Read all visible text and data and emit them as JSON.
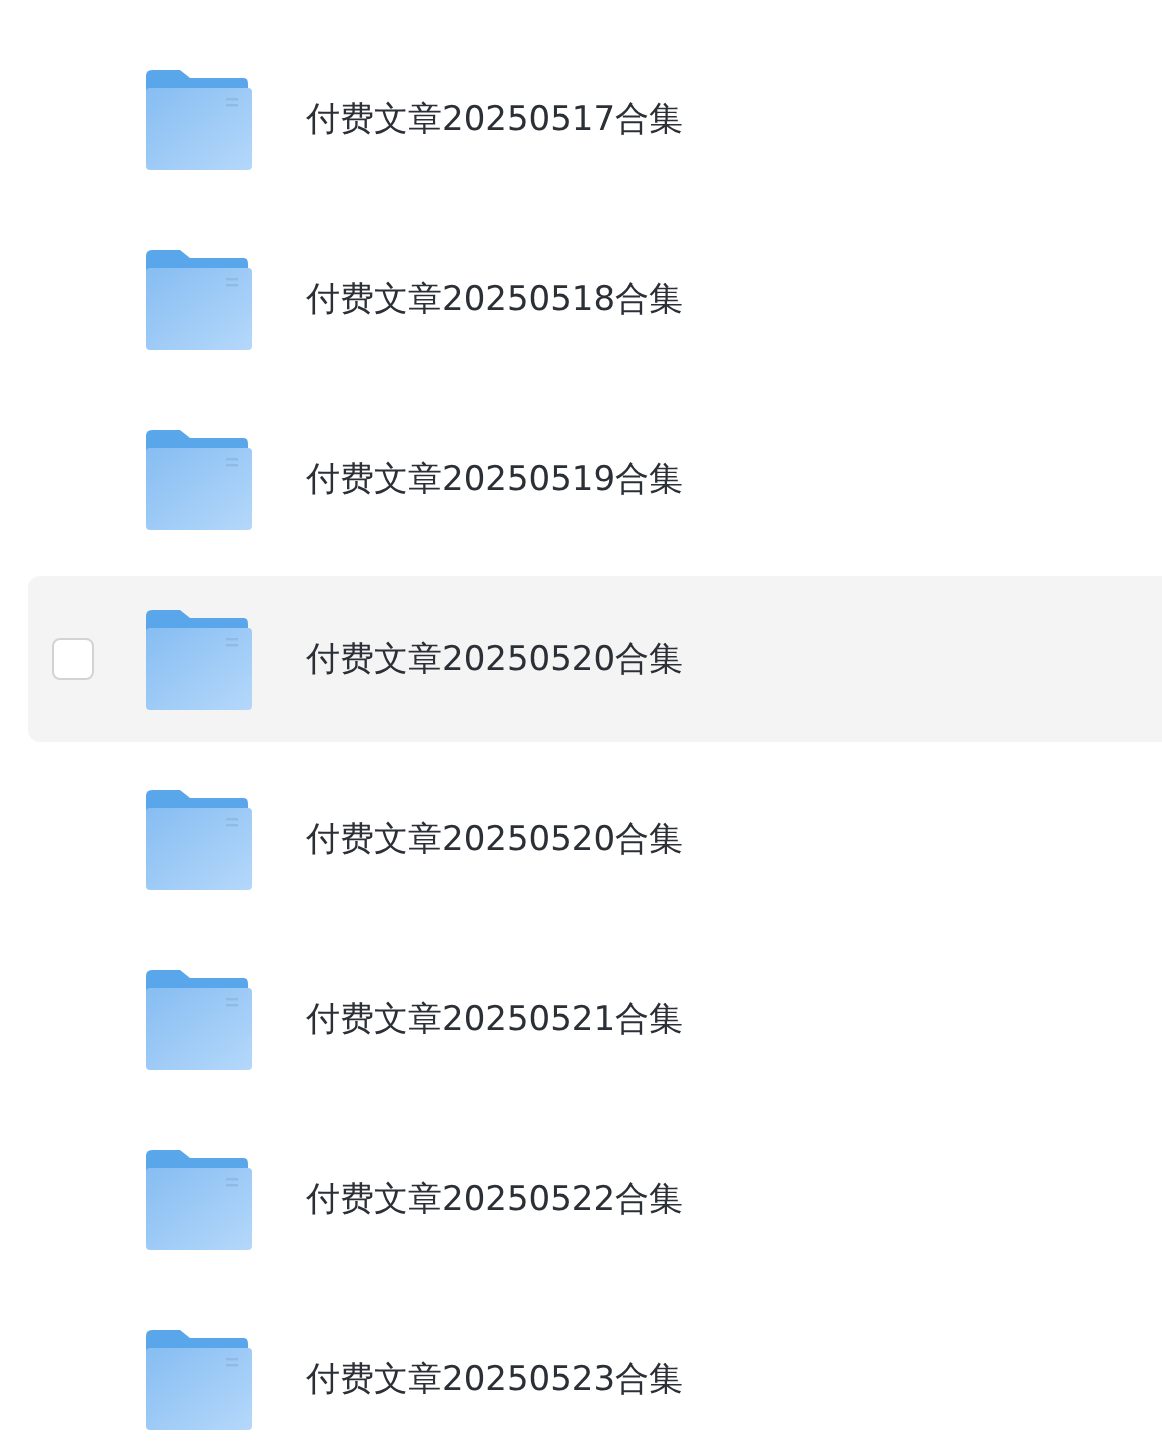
{
  "folders": [
    {
      "name": "付费文章20250517合集",
      "hovered": false
    },
    {
      "name": "付费文章20250518合集",
      "hovered": false
    },
    {
      "name": "付费文章20250519合集",
      "hovered": false
    },
    {
      "name": "付费文章20250520合集",
      "hovered": true
    },
    {
      "name": "付费文章20250520合集",
      "hovered": false
    },
    {
      "name": "付费文章20250521合集",
      "hovered": false
    },
    {
      "name": "付费文章20250522合集",
      "hovered": false
    },
    {
      "name": "付费文章20250523合集",
      "hovered": false
    }
  ]
}
